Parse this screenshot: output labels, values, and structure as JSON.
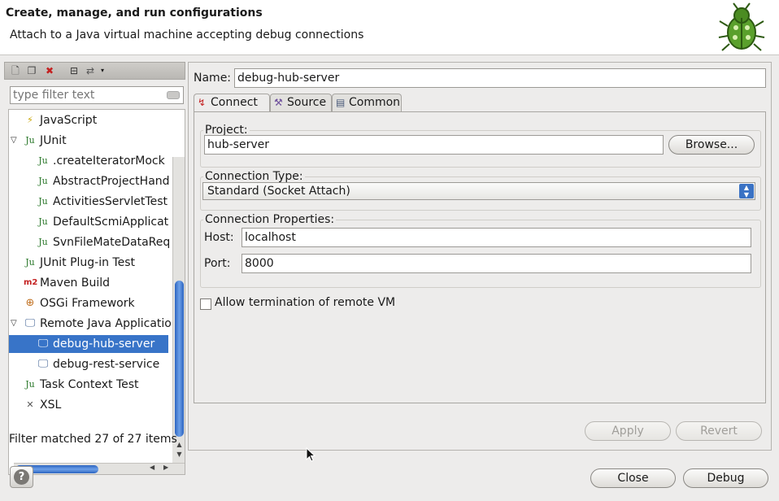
{
  "header": {
    "title": "Create, manage, and run configurations",
    "subtitle": "Attach to a Java virtual machine accepting debug connections",
    "icon": "bug-icon"
  },
  "left": {
    "filter_placeholder": "type filter text",
    "tree": [
      {
        "label": "JavaScript",
        "icon": "javascript-icon"
      },
      {
        "label": "JUnit",
        "icon": "junit-icon",
        "expanded": true
      },
      {
        "label": ".createIteratorMock",
        "icon": "junit-icon"
      },
      {
        "label": "AbstractProjectHand",
        "icon": "junit-icon"
      },
      {
        "label": "ActivitiesServletTest",
        "icon": "junit-icon"
      },
      {
        "label": "DefaultScmiApplicat",
        "icon": "junit-icon"
      },
      {
        "label": "SvnFileMateDataReq",
        "icon": "junit-icon"
      },
      {
        "label": "JUnit Plug-in Test",
        "icon": "junit-plugin-icon"
      },
      {
        "label": "Maven Build",
        "icon": "maven-icon"
      },
      {
        "label": "OSGi Framework",
        "icon": "osgi-icon"
      },
      {
        "label": "Remote Java Applicatio",
        "icon": "remote-java-icon",
        "expanded": true
      },
      {
        "label": "debug-hub-server",
        "icon": "remote-java-icon",
        "selected": true
      },
      {
        "label": "debug-rest-service",
        "icon": "remote-java-icon"
      },
      {
        "label": "Task Context Test",
        "icon": "junit-icon"
      },
      {
        "label": "XSL",
        "icon": "xsl-icon"
      }
    ],
    "status": "Filter matched 27 of 27 items"
  },
  "right": {
    "name_label": "Name:",
    "name_value": "debug-hub-server",
    "tabs": [
      {
        "label": "Connect",
        "icon": "connect-icon",
        "active": true
      },
      {
        "label": "Source",
        "icon": "source-icon"
      },
      {
        "label": "Common",
        "icon": "common-icon"
      }
    ],
    "project": {
      "group_label": "Project:",
      "value": "hub-server",
      "browse_label": "Browse..."
    },
    "connection_type": {
      "group_label": "Connection Type:",
      "selected": "Standard (Socket Attach)"
    },
    "connection_props": {
      "group_label": "Connection Properties:",
      "host_label": "Host:",
      "host_value": "localhost",
      "port_label": "Port:",
      "port_value": "8000"
    },
    "allow_termination_label": "Allow termination of remote VM",
    "apply_label": "Apply",
    "revert_label": "Revert"
  },
  "footer": {
    "close_label": "Close",
    "debug_label": "Debug"
  }
}
